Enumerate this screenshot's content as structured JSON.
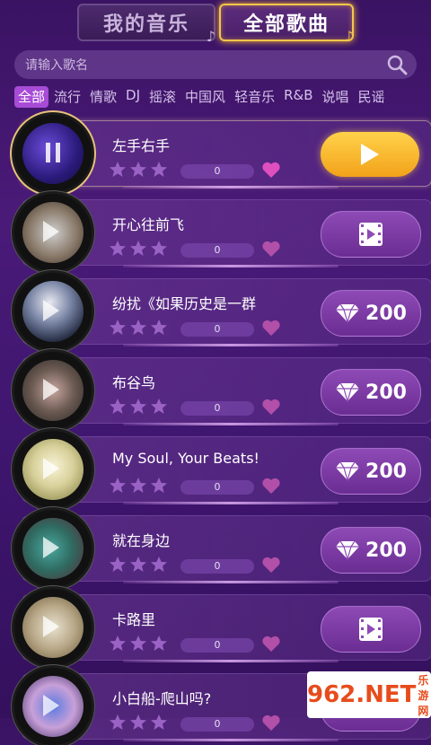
{
  "top_tabs": {
    "mine": "我的音乐",
    "all": "全部歌曲"
  },
  "search": {
    "placeholder": "请输入歌名"
  },
  "genres": [
    "全部",
    "流行",
    "情歌",
    "DJ",
    "摇滚",
    "中国风",
    "轻音乐",
    "R&B",
    "说唱",
    "民谣"
  ],
  "active_genre_index": 0,
  "songs": [
    {
      "title": "左手右手",
      "count": "0",
      "action": "play",
      "state": "playing"
    },
    {
      "title": "开心往前飞",
      "count": "0",
      "action": "video",
      "state": "idle"
    },
    {
      "title": "纷扰《如果历史是一群",
      "count": "0",
      "action": "price",
      "price": "200",
      "state": "idle"
    },
    {
      "title": "布谷鸟",
      "count": "0",
      "action": "price",
      "price": "200",
      "state": "idle"
    },
    {
      "title": "My Soul, Your Beats!",
      "count": "0",
      "action": "price",
      "price": "200",
      "state": "idle"
    },
    {
      "title": "就在身边",
      "count": "0",
      "action": "price",
      "price": "200",
      "state": "idle"
    },
    {
      "title": "卡路里",
      "count": "0",
      "action": "video",
      "state": "idle"
    },
    {
      "title": "小白船-爬山吗?",
      "count": "0",
      "action": "price",
      "price": "200",
      "state": "idle"
    }
  ],
  "watermark": {
    "brand": "962.NET",
    "sub": "乐游网"
  },
  "colors": {
    "accent_gold": "#f2c64a",
    "purple": "#4a1a78",
    "heart": "#d845b6"
  }
}
